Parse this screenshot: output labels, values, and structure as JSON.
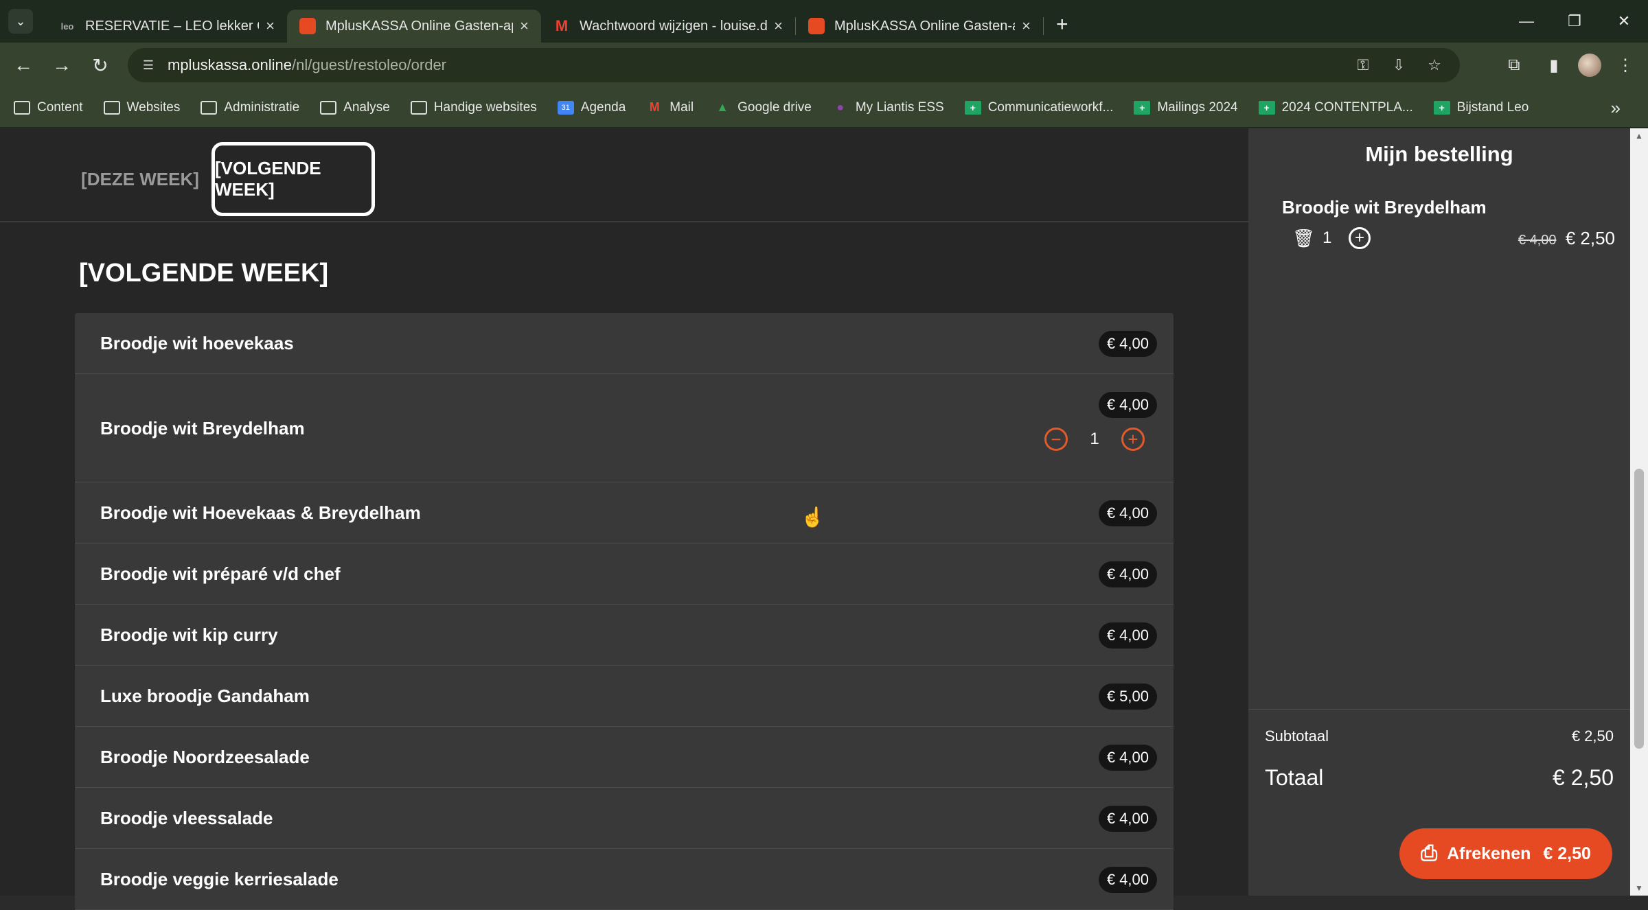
{
  "browser": {
    "tabs": [
      {
        "title": "RESERVATIE – LEO lekker Oost-V",
        "favicon": "leo",
        "active": false
      },
      {
        "title": "MplusKASSA Online Gasten-app",
        "favicon": "mpluskassa",
        "active": true
      },
      {
        "title": "Wachtwoord wijzigen - louise.d",
        "favicon": "gmail",
        "active": false
      },
      {
        "title": "MplusKASSA Online Gasten-app",
        "favicon": "mpluskassa",
        "active": false
      }
    ],
    "url_domain": "mpluskassa.online",
    "url_path": "/nl/guest/restoleo/order",
    "bookmarks": [
      {
        "label": "Content",
        "icon": "folder-icon"
      },
      {
        "label": "Websites",
        "icon": "folder-icon"
      },
      {
        "label": "Administratie",
        "icon": "folder-icon"
      },
      {
        "label": "Analyse",
        "icon": "folder-icon"
      },
      {
        "label": "Handige websites",
        "icon": "folder-icon"
      },
      {
        "label": "Agenda",
        "icon": "calendar-icon"
      },
      {
        "label": "Mail",
        "icon": "gmail-icon"
      },
      {
        "label": "Google drive",
        "icon": "drive-icon"
      },
      {
        "label": "My Liantis ESS",
        "icon": "liantis-icon"
      },
      {
        "label": "Communicatieworkf...",
        "icon": "sheets-icon"
      },
      {
        "label": "Mailings 2024",
        "icon": "sheets-icon"
      },
      {
        "label": "2024 CONTENTPLA...",
        "icon": "sheets-icon"
      },
      {
        "label": "Bijstand Leo",
        "icon": "sheets-icon"
      }
    ]
  },
  "weeks": {
    "this_week": "[DEZE WEEK]",
    "next_week": "[VOLGENDE WEEK]"
  },
  "section_title": "[VOLGENDE WEEK]",
  "menu": [
    {
      "name": "Broodje wit hoevekaas",
      "price": "€ 4,00"
    },
    {
      "name": "Broodje wit Breydelham",
      "price": "€ 4,00",
      "quantity": "1"
    },
    {
      "name": "Broodje wit Hoevekaas & Breydelham",
      "price": "€ 4,00"
    },
    {
      "name": "Broodje wit préparé v/d chef",
      "price": "€ 4,00"
    },
    {
      "name": "Broodje wit kip curry",
      "price": "€ 4,00"
    },
    {
      "name": "Luxe broodje Gandaham",
      "price": "€ 5,00"
    },
    {
      "name": "Broodje Noordzeesalade",
      "price": "€ 4,00"
    },
    {
      "name": "Broodje vleessalade",
      "price": "€ 4,00"
    },
    {
      "name": "Broodje veggie kerriesalade",
      "price": "€ 4,00"
    }
  ],
  "order": {
    "title": "Mijn bestelling",
    "items": [
      {
        "name": "Broodje wit Breydelham",
        "quantity": "1",
        "old_price": "€ 4,00",
        "price": "€ 2,50"
      }
    ],
    "subtotal_label": "Subtotaal",
    "subtotal": "€ 2,50",
    "total_label": "Totaal",
    "total": "€ 2,50",
    "checkout_label": "Afrekenen",
    "checkout_amount": "€ 2,50"
  },
  "colors": {
    "accent": "#e64a22",
    "qty_control": "#e05a2c",
    "browser_frame": "#35432f"
  }
}
